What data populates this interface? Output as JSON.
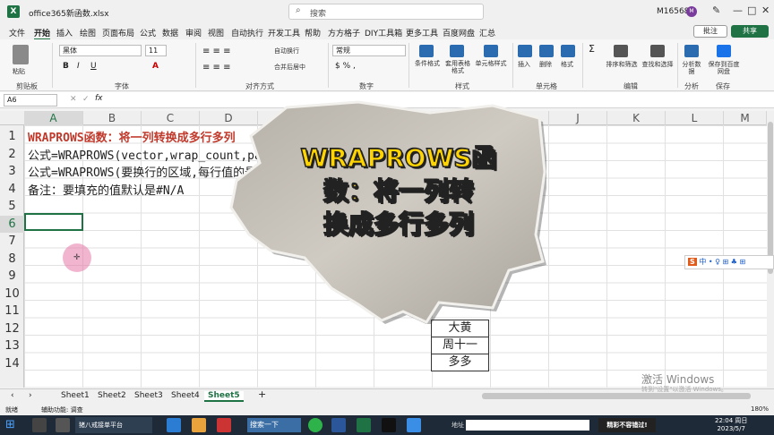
{
  "app": {
    "filename": "office365新函数.xlsx",
    "search_placeholder": "搜索",
    "user_id": "M16568",
    "avatar_letter": "M",
    "win_min": "—",
    "win_max": "□",
    "win_close": "✕",
    "win_pen": "✎",
    "accent": "#1f7244"
  },
  "menu": {
    "items": [
      "文件",
      "开始",
      "插入",
      "绘图",
      "页面布局",
      "公式",
      "数据",
      "审阅",
      "视图",
      "自动执行",
      "开发工具",
      "帮助",
      "方方格子",
      "DIY工具箱",
      "更多工具",
      "百度网盘",
      "汇总"
    ],
    "comment": "批注",
    "share": "共享"
  },
  "ribbon": {
    "groups": [
      "剪贴板",
      "字体",
      "对齐方式",
      "数字",
      "样式",
      "单元格",
      "编辑",
      "分析",
      "保存"
    ],
    "font_name": "黑体",
    "font_size": "11",
    "number_format": "常规",
    "wrap": "自动换行",
    "merge": "合并后居中",
    "cond_format": "条件格式",
    "table_format": "套用表格格式",
    "cell_style": "单元格样式",
    "insert": "插入",
    "delete": "删除",
    "format": "格式",
    "sort": "排序和筛选",
    "find": "查找和选择",
    "analyze": "分析数据",
    "save_baidu": "保存到百度网盘",
    "paste": "粘贴"
  },
  "formula_bar": {
    "name_box": "A6",
    "fx": "fx"
  },
  "grid": {
    "columns": [
      "A",
      "B",
      "C",
      "D",
      "E",
      "F",
      "G",
      "H",
      "I",
      "J",
      "K",
      "L",
      "M"
    ],
    "rows": [
      "1",
      "2",
      "3",
      "4",
      "5",
      "6",
      "7",
      "8",
      "9",
      "10",
      "11",
      "12",
      "13",
      "14"
    ],
    "row1": "WRAPROWS函数：将一列转换成多行多列",
    "row2": "公式=WRAPROWS(vector,wrap_count,pad_with)",
    "row3": "公式=WRAPROWS(要换行的区域,每行值的最大数,填充的值)",
    "row4": "备注：要填充的值默认是#N/A",
    "cell_12": "大黄",
    "cell_13": "周十一",
    "cell_14": "多多"
  },
  "overlay": {
    "line1": "WRAPROWS函",
    "line2": "数：将一列转",
    "line3": "换成多行多列"
  },
  "sheets": {
    "tabs": [
      "Sheet1",
      "Sheet2",
      "Sheet3",
      "Sheet4",
      "Sheet5"
    ],
    "active": "Sheet5",
    "add": "+"
  },
  "status": {
    "left": "就绪",
    "accessibility": "辅助功能: 调查",
    "zoom": "180%"
  },
  "ime": {
    "logo": "S",
    "text": "中 • ♀ ⊞ ♣ ⊞"
  },
  "watermark": {
    "line1": "激活 Windows",
    "line2": "转到\"设置\"以激活 Windows。"
  },
  "taskbar": {
    "search": "搜索一下",
    "app_label": "猪八戒接单平台",
    "address": "地址",
    "ad": "精彩不容错过!",
    "time": "22:04 周日",
    "date": "2023/5/7"
  }
}
